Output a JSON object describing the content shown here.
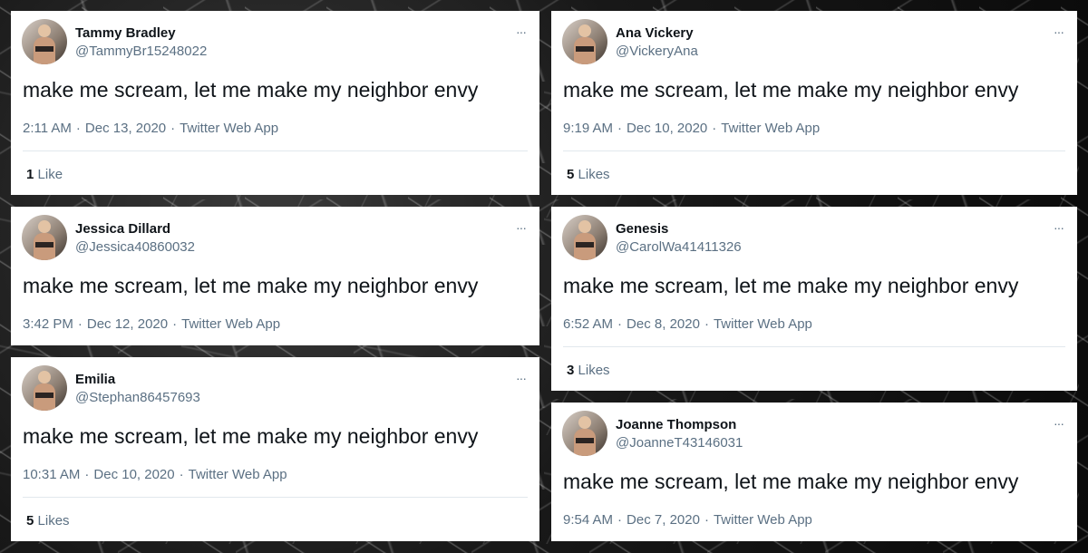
{
  "tweets": [
    {
      "name": "Tammy Bradley",
      "handle": "@TammyBr15248022",
      "text": "make me scream, let me make my neighbor envy",
      "time": "2:11 AM",
      "date": "Dec 13, 2020",
      "source": "Twitter Web App",
      "likes_count": "1",
      "likes_label": "Like"
    },
    {
      "name": "Ana Vickery",
      "handle": "@VickeryAna",
      "text": "make me scream, let me make my neighbor envy",
      "time": "9:19 AM",
      "date": "Dec 10, 2020",
      "source": "Twitter Web App",
      "likes_count": "5",
      "likes_label": "Likes"
    },
    {
      "name": "Jessica Dillard",
      "handle": "@Jessica40860032",
      "text": "make me scream, let me make my neighbor envy",
      "time": "3:42 PM",
      "date": "Dec 12, 2020",
      "source": "Twitter Web App"
    },
    {
      "name": "Genesis",
      "handle": "@CarolWa41411326",
      "text": "make me scream, let me make my neighbor envy",
      "time": "6:52 AM",
      "date": "Dec 8, 2020",
      "source": "Twitter Web App",
      "likes_count": "3",
      "likes_label": "Likes"
    },
    {
      "name": "Emilia",
      "handle": "@Stephan86457693",
      "text": "make me scream, let me make my neighbor envy",
      "time": "10:31 AM",
      "date": "Dec 10, 2020",
      "source": "Twitter Web App",
      "likes_count": "5",
      "likes_label": "Likes"
    },
    {
      "name": "Joanne Thompson",
      "handle": "@JoanneT43146031",
      "text": "make me scream, let me make my neighbor envy",
      "time": "9:54 AM",
      "date": "Dec 7, 2020",
      "source": "Twitter Web App"
    }
  ],
  "more_icon": "···",
  "separator": "·"
}
